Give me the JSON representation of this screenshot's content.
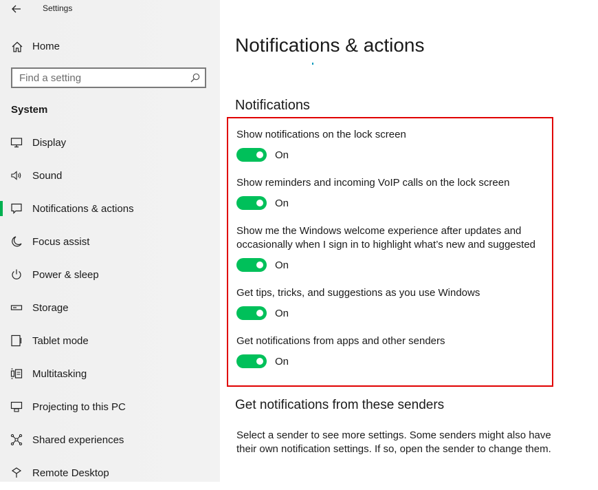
{
  "app": {
    "title": "Settings"
  },
  "sidebar": {
    "home_label": "Home",
    "search_placeholder": "Find a setting",
    "section_title": "System",
    "items": [
      {
        "label": "Display",
        "icon": "monitor-icon"
      },
      {
        "label": "Sound",
        "icon": "speaker-icon"
      },
      {
        "label": "Notifications & actions",
        "icon": "notification-icon",
        "active": true
      },
      {
        "label": "Focus assist",
        "icon": "moon-icon"
      },
      {
        "label": "Power & sleep",
        "icon": "power-icon"
      },
      {
        "label": "Storage",
        "icon": "storage-icon"
      },
      {
        "label": "Tablet mode",
        "icon": "tablet-icon"
      },
      {
        "label": "Multitasking",
        "icon": "multitasking-icon"
      },
      {
        "label": "Projecting to this PC",
        "icon": "projecting-icon"
      },
      {
        "label": "Shared experiences",
        "icon": "shared-icon"
      },
      {
        "label": "Remote Desktop",
        "icon": "remote-desktop-icon"
      }
    ]
  },
  "main": {
    "title": "Notifications & actions",
    "notifications_heading": "Notifications",
    "settings": [
      {
        "text": "Show notifications on the lock screen",
        "state": "On"
      },
      {
        "text": "Show reminders and incoming VoIP calls on the lock screen",
        "state": "On"
      },
      {
        "text": "Show me the Windows welcome experience after updates and occasionally when I sign in to highlight what’s new and suggested",
        "state": "On"
      },
      {
        "text": "Get tips, tricks, and suggestions as you use Windows",
        "state": "On"
      },
      {
        "text": "Get notifications from apps and other senders",
        "state": "On"
      }
    ],
    "senders_heading": "Get notifications from these senders",
    "senders_description": "Select a sender to see more settings. Some senders might also have their own notification settings. If so, open the sender to change them."
  },
  "colors": {
    "accent": "#00c05a",
    "highlight_box": "#e00000",
    "active_bar": "#00b050"
  }
}
